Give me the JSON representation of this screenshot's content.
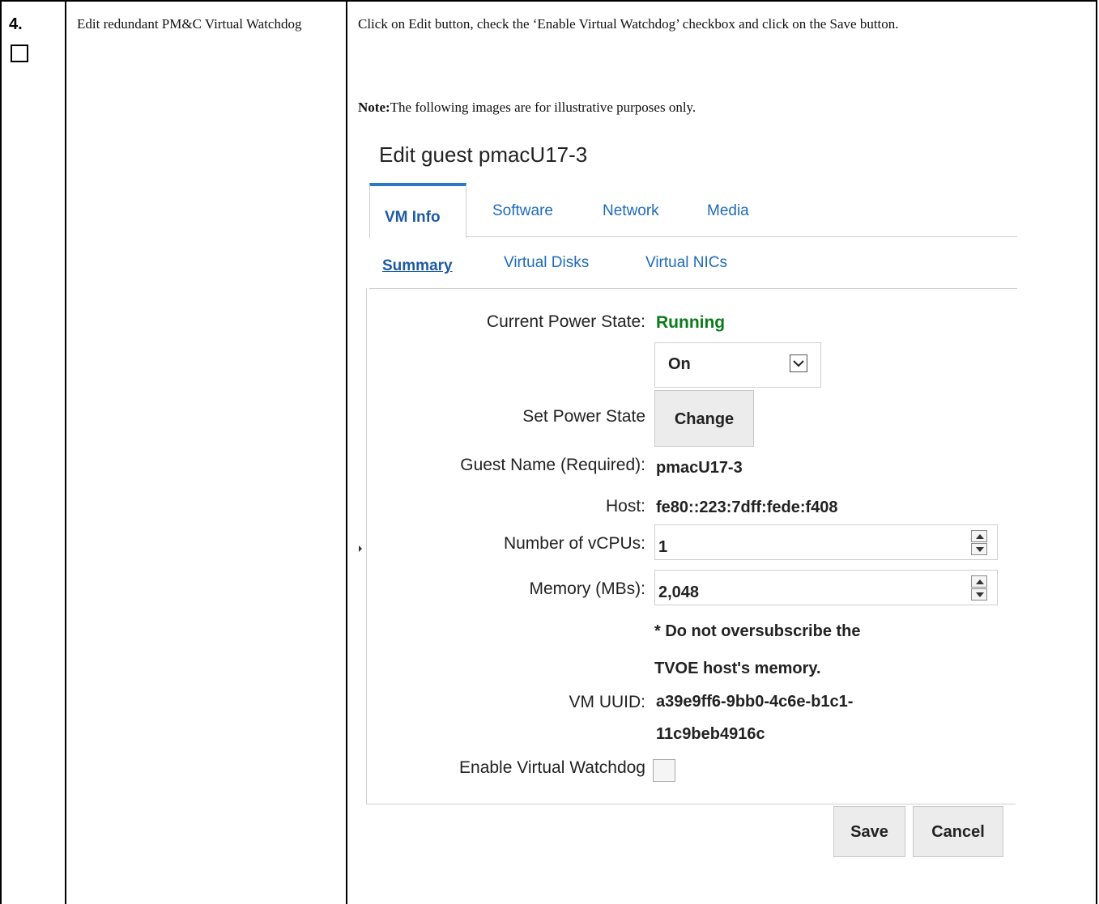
{
  "step": {
    "number": "4.",
    "name": "Edit redundant PM&C Virtual Watchdog",
    "instruction": "Click on Edit button, check the ‘Enable Virtual Watchdog’ checkbox and click on the Save button.",
    "note_label": "Note:",
    "note_text": "The following images are for illustrative purposes only."
  },
  "dialog": {
    "title": "Edit guest pmacU17-3",
    "tabs": [
      {
        "label": "VM Info",
        "active": true
      },
      {
        "label": "Software",
        "active": false
      },
      {
        "label": "Network",
        "active": false
      },
      {
        "label": "Media",
        "active": false
      }
    ],
    "subtabs": [
      {
        "label": "Summary",
        "active": true
      },
      {
        "label": "Virtual Disks",
        "active": false
      },
      {
        "label": "Virtual NICs",
        "active": false
      }
    ],
    "fields": {
      "power_state_label": "Current Power State:",
      "power_state_value": "Running",
      "power_select_value": "On",
      "set_power_label": "Set Power State",
      "change_button": "Change",
      "guest_name_label": "Guest Name (Required):",
      "guest_name_value": "pmacU17-3",
      "host_label": "Host:",
      "host_value": "fe80::223:7dff:fede:f408",
      "vcpus_label": "Number of vCPUs:",
      "vcpus_value": "1",
      "memory_label": "Memory (MBs):",
      "memory_value": "2,048",
      "memory_warning_1": "* Do not oversubscribe the",
      "memory_warning_2": "TVOE host's memory.",
      "uuid_label": "VM UUID:",
      "uuid_value_1": "a39e9ff6-9bb0-4c6e-b1c1-",
      "uuid_value_2": "11c9beb4916c",
      "watchdog_label": "Enable Virtual Watchdog",
      "watchdog_checked": false
    },
    "buttons": {
      "save": "Save",
      "cancel": "Cancel"
    },
    "colors": {
      "link": "#1e6bb8",
      "running": "#0b7a1a",
      "button_bg": "#ececec"
    }
  }
}
